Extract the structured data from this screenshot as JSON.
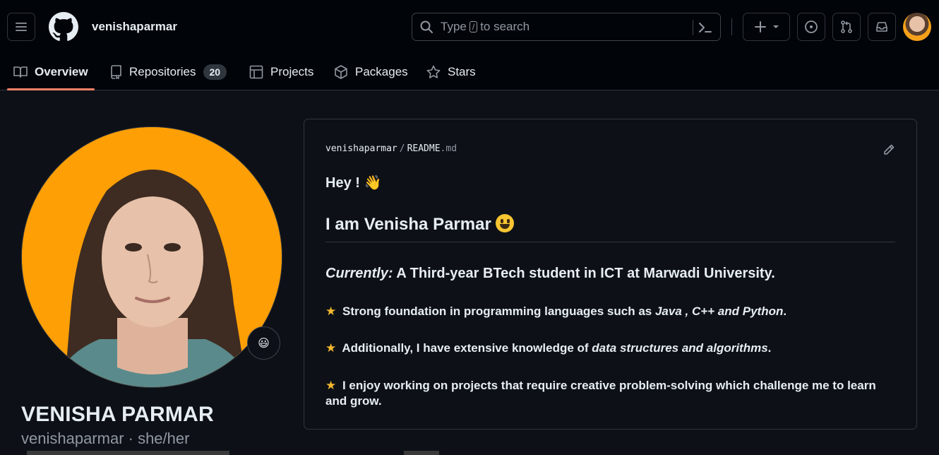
{
  "header": {
    "username": "venishaparmar",
    "search": {
      "prefix": "Type",
      "kbd": "/",
      "suffix": "to search"
    }
  },
  "tabs": [
    {
      "label": "Overview",
      "icon": "book-icon",
      "active": true
    },
    {
      "label": "Repositories",
      "icon": "repo-icon",
      "count": "20"
    },
    {
      "label": "Projects",
      "icon": "table-icon"
    },
    {
      "label": "Packages",
      "icon": "package-icon"
    },
    {
      "label": "Stars",
      "icon": "star-icon"
    }
  ],
  "profile": {
    "full_name": "VENISHA PARMAR",
    "login_pronouns": "venishaparmar · she/her",
    "status_emoji": "😃",
    "photo_bg": "#ff9f06"
  },
  "readme": {
    "path_user": "venishaparmar",
    "path_sep": "/",
    "path_file": "README",
    "path_ext": ".md",
    "greeting": "Hey !",
    "greeting_emoji": "👋",
    "heading": "I am Venisha Parmar",
    "currently_label": "Currently:",
    "currently_text": " A Third-year BTech student in ICT at Marwadi University.",
    "star_glyph": "★",
    "p1_text": "Strong foundation in programming languages such as ",
    "p1_em": "Java , C++ and Python",
    "p1_end": ".",
    "p2_text": "Additionally, I have extensive knowledge of ",
    "p2_em": "data structures and algorithms",
    "p2_end": ".",
    "p3_text": "I enjoy working on projects that require creative problem-solving which challenge me to learn and grow."
  },
  "colors": {
    "bg": "#0d1117",
    "header_bg": "#010409",
    "border": "#30363d",
    "muted": "#9198a1",
    "accent_underline": "#f78166",
    "star": "#f5b82e"
  }
}
